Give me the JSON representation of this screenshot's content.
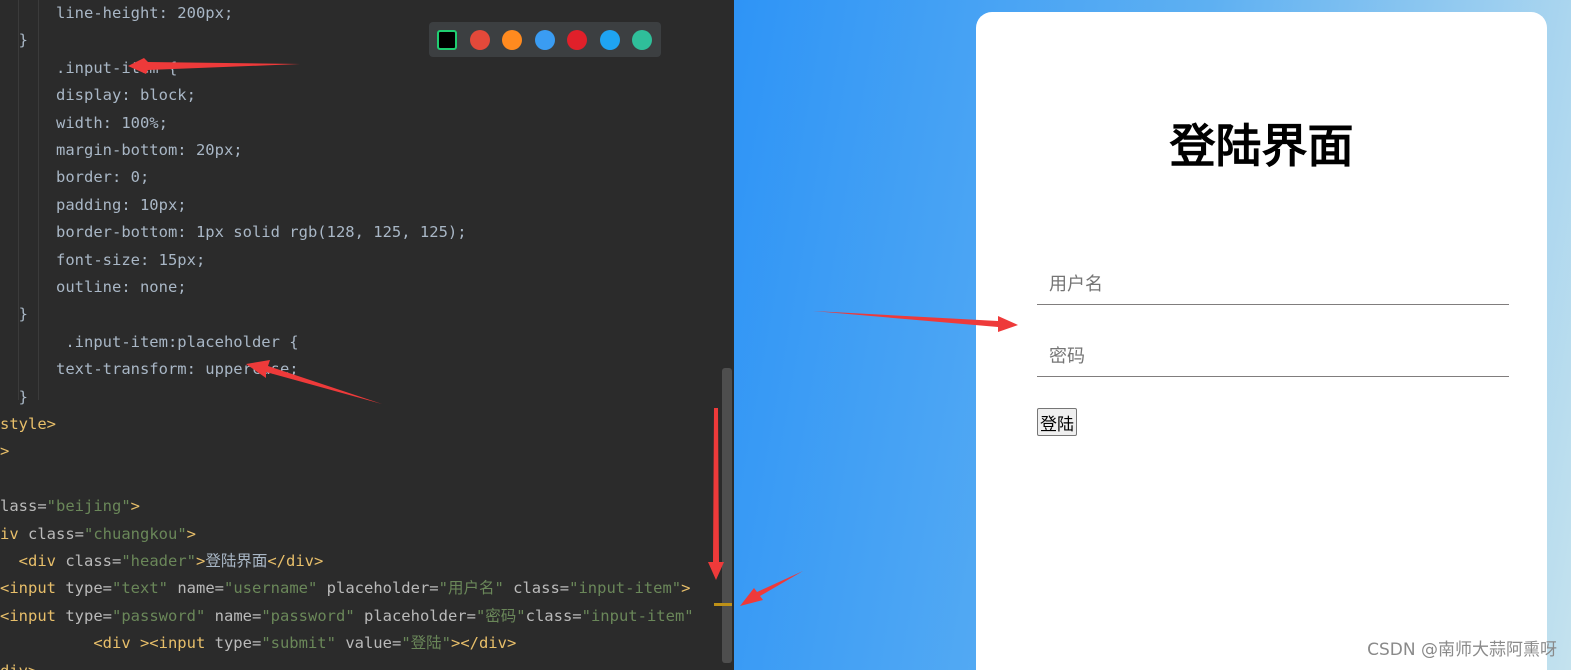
{
  "colors": {
    "editor_bg": "#2b2b2b",
    "css_default": "#a9b7c6",
    "tag": "#e8bf6a",
    "attr": "#bababa",
    "string": "#6a8759",
    "annotation_arrow": "#ee3a3a",
    "card_bg": "#ffffff"
  },
  "editor": {
    "lines": [
      [
        {
          "t": "      line-height: 200px;",
          "c": "css_default"
        }
      ],
      [
        {
          "t": "  }",
          "c": "css_default"
        }
      ],
      [
        {
          "t": "      .input-item {",
          "c": "css_default"
        }
      ],
      [
        {
          "t": "      display: block;",
          "c": "css_default"
        }
      ],
      [
        {
          "t": "      width: 100%;",
          "c": "css_default"
        }
      ],
      [
        {
          "t": "      margin-bottom: 20px;",
          "c": "css_default"
        }
      ],
      [
        {
          "t": "      border: 0;",
          "c": "css_default"
        }
      ],
      [
        {
          "t": "      padding: 10px;",
          "c": "css_default"
        }
      ],
      [
        {
          "t": "      border-bottom: 1px solid rgb(128, 125, 125);",
          "c": "css_default"
        }
      ],
      [
        {
          "t": "      font-size: 15px;",
          "c": "css_default"
        }
      ],
      [
        {
          "t": "      outline: none;",
          "c": "css_default"
        }
      ],
      [
        {
          "t": "  }",
          "c": "css_default"
        }
      ],
      [
        {
          "t": "       .input-item:placeholder {",
          "c": "css_default"
        }
      ],
      [
        {
          "t": "      text-transform: uppercase;",
          "c": "css_default"
        }
      ],
      [
        {
          "t": "  }",
          "c": "css_default"
        }
      ],
      [
        {
          "t": "style>",
          "c": "tag"
        }
      ],
      [
        {
          "t": ">",
          "c": "tag"
        }
      ],
      [
        {
          "t": "",
          "c": "css_default"
        }
      ],
      [
        {
          "t": "lass=",
          "c": "attr"
        },
        {
          "t": "\"beijing\"",
          "c": "string"
        },
        {
          "t": ">",
          "c": "tag"
        }
      ],
      [
        {
          "t": "iv ",
          "c": "tag"
        },
        {
          "t": "class=",
          "c": "attr"
        },
        {
          "t": "\"chuangkou\"",
          "c": "string"
        },
        {
          "t": ">",
          "c": "tag"
        }
      ],
      [
        {
          "t": "  <div ",
          "c": "tag"
        },
        {
          "t": "class=",
          "c": "attr"
        },
        {
          "t": "\"header\"",
          "c": "string"
        },
        {
          "t": ">",
          "c": "tag"
        },
        {
          "t": "登陆界面",
          "c": "css_default"
        },
        {
          "t": "</div>",
          "c": "tag"
        }
      ],
      [
        {
          "t": "<input ",
          "c": "tag"
        },
        {
          "t": "type=",
          "c": "attr"
        },
        {
          "t": "\"text\" ",
          "c": "string"
        },
        {
          "t": "name=",
          "c": "attr"
        },
        {
          "t": "\"username\" ",
          "c": "string"
        },
        {
          "t": "placeholder=",
          "c": "attr"
        },
        {
          "t": "\"用户名\" ",
          "c": "string"
        },
        {
          "t": "class=",
          "c": "attr"
        },
        {
          "t": "\"input-item\"",
          "c": "string"
        },
        {
          "t": ">",
          "c": "tag"
        }
      ],
      [
        {
          "t": "<input ",
          "c": "tag"
        },
        {
          "t": "type=",
          "c": "attr"
        },
        {
          "t": "\"password\" ",
          "c": "string"
        },
        {
          "t": "name=",
          "c": "attr"
        },
        {
          "t": "\"password\" ",
          "c": "string"
        },
        {
          "t": "placeholder=",
          "c": "attr"
        },
        {
          "t": "\"密码\"",
          "c": "string"
        },
        {
          "t": "class=",
          "c": "attr"
        },
        {
          "t": "\"input-item\"",
          "c": "string"
        }
      ],
      [
        {
          "t": "          <div ><input ",
          "c": "tag"
        },
        {
          "t": "type=",
          "c": "attr"
        },
        {
          "t": "\"submit\" ",
          "c": "string"
        },
        {
          "t": "value=",
          "c": "attr"
        },
        {
          "t": "\"登陆\"",
          "c": "string"
        },
        {
          "t": "></div>",
          "c": "tag"
        }
      ],
      [
        {
          "t": "div>",
          "c": "tag"
        }
      ]
    ]
  },
  "browser_bar": {
    "icons": [
      {
        "name": "pycharm-icon",
        "color": "#1fce71"
      },
      {
        "name": "chrome-icon",
        "color": "#e3493a"
      },
      {
        "name": "firefox-icon",
        "color": "#ff8a1f"
      },
      {
        "name": "safari-icon",
        "color": "#3a9cf2"
      },
      {
        "name": "opera-icon",
        "color": "#e0202a"
      },
      {
        "name": "ie-icon",
        "color": "#1fa4f2"
      },
      {
        "name": "edge-icon",
        "color": "#2fbf9a"
      }
    ]
  },
  "preview": {
    "title": "登陆界面",
    "username_placeholder": "用户名",
    "password_placeholder": "密码",
    "submit_label": "登陆"
  },
  "watermark": "CSDN @南师大蒜阿熏呀"
}
